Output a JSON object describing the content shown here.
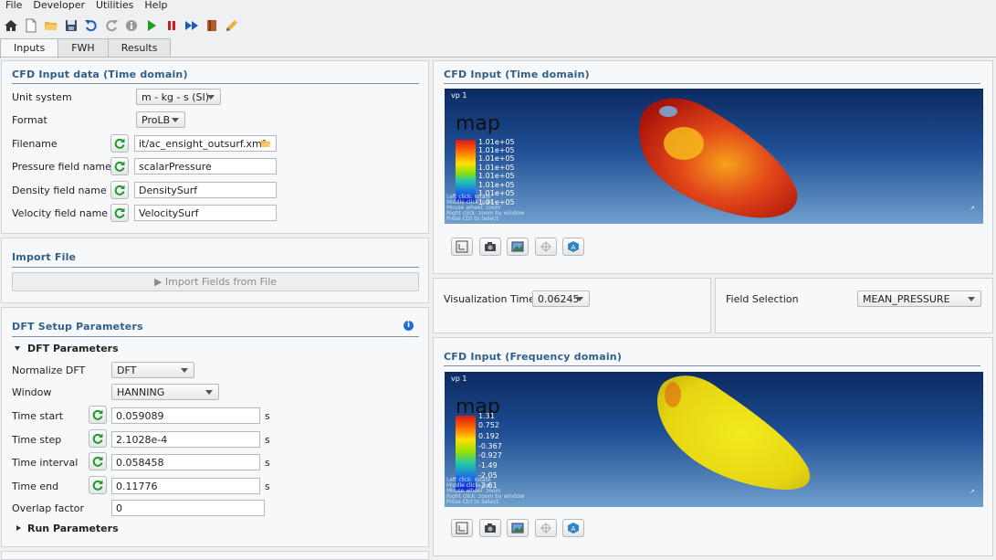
{
  "menu": [
    "File",
    "Developer",
    "Utilities",
    "Help"
  ],
  "toolbar": [
    "home-icon",
    "new-file-icon",
    "open-folder-icon",
    "save-icon",
    "undo-icon",
    "redo-icon",
    "info-icon",
    "run-icon",
    "stop-icon",
    "fast-forward-icon",
    "book-icon",
    "pencil-icon"
  ],
  "tabs": [
    "Inputs",
    "FWH",
    "Results"
  ],
  "cfd_input": {
    "title": "CFD Input data (Time domain)",
    "unit_system_label": "Unit system",
    "unit_system_value": "m - kg - s (SI)",
    "format_label": "Format",
    "format_value": "ProLB",
    "filename_label": "Filename",
    "filename_value": "it/ac_ensight_outsurf.xmf",
    "pressure_label": "Pressure field name",
    "pressure_value": "scalarPressure",
    "density_label": "Density field name",
    "density_value": "DensitySurf",
    "velocity_label": "Velocity field name",
    "velocity_value": "VelocitySurf"
  },
  "import_file": {
    "title": "Import File",
    "button_label": "▶ Import Fields from File"
  },
  "dft": {
    "title": "DFT Setup Parameters",
    "section_label": "DFT Parameters",
    "normalize_label": "Normalize DFT",
    "normalize_value": "DFT",
    "window_label": "Window",
    "window_value": "HANNING",
    "time_start_label": "Time start",
    "time_start_value": "0.059089",
    "time_step_label": "Time step",
    "time_step_value": "2.1028e-4",
    "time_interval_label": "Time interval",
    "time_interval_value": "0.058458",
    "time_end_label": "Time end",
    "time_end_value": "0.11776",
    "overlap_label": "Overlap factor",
    "overlap_value": "0",
    "unit": "s",
    "run_label": "Run Parameters"
  },
  "viewer_time": {
    "title": "CFD Input (Time domain)",
    "vp": "vp 1",
    "map_label": "map",
    "ticks": [
      "1.01e+05",
      "1.01e+05",
      "1.01e+05",
      "1.01e+05",
      "1.01e+05",
      "1.01e+05",
      "1.01e+05",
      "1.01e+05"
    ],
    "hints": [
      "Left click: rotate",
      "Middle click: pan",
      "Mouse wheel: zoom",
      "Right click: zoom by window",
      "Press Ctrl to Select"
    ]
  },
  "viz_time": {
    "label": "Visualization Time",
    "value": "0.06245"
  },
  "field_selection": {
    "label": "Field Selection",
    "value": "MEAN_PRESSURE"
  },
  "viewer_freq": {
    "title": "CFD Input (Frequency domain)",
    "vp": "vp 1",
    "map_label": "map",
    "ticks": [
      "1.31",
      "0.752",
      "0.192",
      "-0.367",
      "-0.927",
      "-1.49",
      "-2.05",
      "-2.61"
    ],
    "hints": [
      "Left click: rotate",
      "Middle click: pan",
      "Mouse wheel: zoom",
      "Right click: zoom by window",
      "Press Ctrl to Select"
    ]
  },
  "viewer_buttons": [
    "axes-icon",
    "camera-icon",
    "image-export-icon",
    "pick-icon",
    "view-cube-icon"
  ],
  "colors": {
    "accent": "#2f5f8a",
    "run": "#18a018",
    "stop": "#d01c1c"
  }
}
